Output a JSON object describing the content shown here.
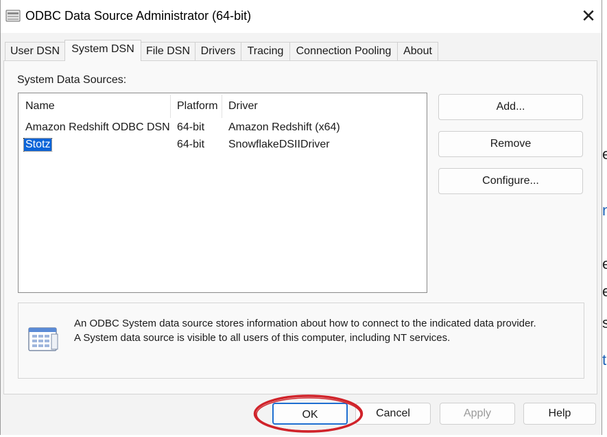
{
  "window": {
    "title": "ODBC Data Source Administrator (64-bit)",
    "close_glyph": "✕"
  },
  "tabs": [
    {
      "label": "User DSN",
      "active": false
    },
    {
      "label": "System DSN",
      "active": true
    },
    {
      "label": "File DSN",
      "active": false
    },
    {
      "label": "Drivers",
      "active": false
    },
    {
      "label": "Tracing",
      "active": false
    },
    {
      "label": "Connection Pooling",
      "active": false
    },
    {
      "label": "About",
      "active": false
    }
  ],
  "system_dsn": {
    "section_label": "System Data Sources:",
    "columns": [
      "Name",
      "Platform",
      "Driver"
    ],
    "rows": [
      {
        "name": "Amazon Redshift ODBC DSN",
        "platform": "64-bit",
        "driver": "Amazon Redshift (x64)",
        "selected": false
      },
      {
        "name": "Stotz",
        "platform": "64-bit",
        "driver": "SnowflakeDSIIDriver",
        "selected": true
      }
    ],
    "buttons": {
      "add": "Add...",
      "remove": "Remove",
      "configure": "Configure..."
    },
    "info": {
      "line1": "An ODBC System data source stores information about how to connect to the indicated data provider.",
      "line2": "A System data source is visible to all users of this computer, including NT services."
    }
  },
  "footer": {
    "ok": "OK",
    "cancel": "Cancel",
    "apply": "Apply",
    "help": "Help",
    "apply_enabled": false
  },
  "annotation": {
    "color": "#d0232a",
    "target": "OK"
  },
  "colors": {
    "selection": "#0a64d8",
    "default_button_border": "#1f6fd1"
  }
}
